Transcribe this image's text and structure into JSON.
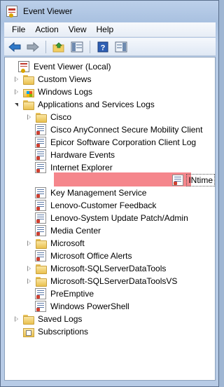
{
  "window": {
    "title": "Event Viewer"
  },
  "menu": [
    "File",
    "Action",
    "View",
    "Help"
  ],
  "toolbar": {
    "buttons": [
      "back-arrow-icon",
      "forward-arrow-icon",
      "up-folder-icon",
      "show-hide-tree-icon",
      "help-icon",
      "show-hide-action-pane-icon"
    ]
  },
  "tree": {
    "root": "Event Viewer (Local)",
    "level1": [
      {
        "label": "Custom Views"
      },
      {
        "label": "Windows Logs"
      },
      {
        "label": "Applications and Services Logs"
      }
    ],
    "apps": [
      {
        "label": "Cisco"
      },
      {
        "label": "Cisco AnyConnect Secure Mobility Client"
      },
      {
        "label": "Epicor Software Corporation Client Log"
      },
      {
        "label": "Hardware Events"
      },
      {
        "label": "Internet Explorer"
      },
      {
        "label": "INtime"
      },
      {
        "label": "Key Management Service"
      },
      {
        "label": "Lenovo-Customer Feedback"
      },
      {
        "label": "Lenovo-System Update Patch/Admin"
      },
      {
        "label": "Media Center"
      },
      {
        "label": "Microsoft"
      },
      {
        "label": "Microsoft Office Alerts"
      },
      {
        "label": "Microsoft-SQLServerDataTools"
      },
      {
        "label": "Microsoft-SQLServerDataToolsVS"
      },
      {
        "label": "PreEmptive"
      },
      {
        "label": "Windows PowerShell"
      }
    ],
    "bottom": [
      {
        "label": "Saved Logs"
      },
      {
        "label": "Subscriptions"
      }
    ],
    "selected": "INtime",
    "highlight_color": "#f47f86"
  }
}
